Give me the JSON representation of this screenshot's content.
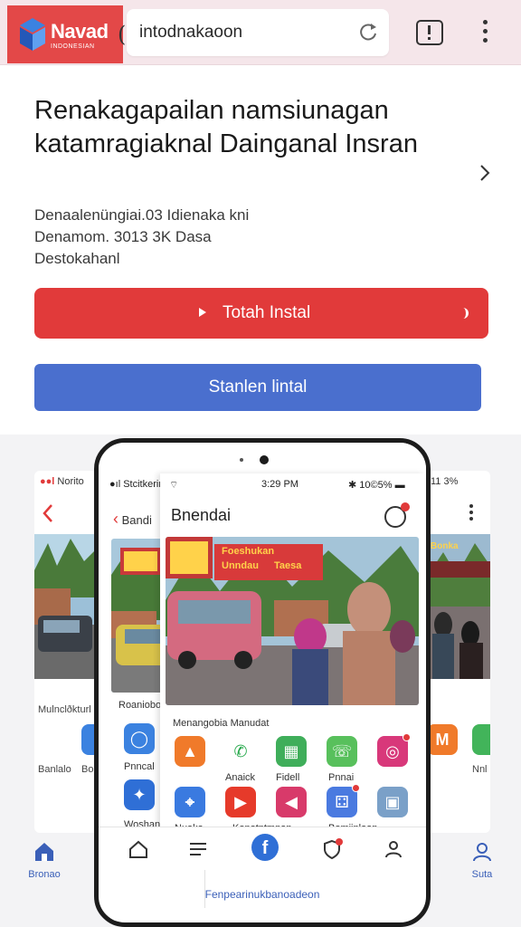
{
  "browser": {
    "logo_text": "Navad",
    "logo_sub": "INDONESIAN",
    "url": "intodnakaoon",
    "paren": "("
  },
  "main": {
    "title": "Renakagapailan namsiunagan katamragiaknal Dainganal Insran",
    "description_lines": [
      "Denaalenüngiai.03 Idienaka kni",
      "Denamom. 3013 3K Dasa",
      "Destokahanl"
    ],
    "primary_button": "Totah Instal",
    "secondary_button": "Stanlen lintal"
  },
  "preview": {
    "left_card": {
      "status": "Norito",
      "back_label": "",
      "caption": "Mulnclðkturl",
      "bottom_caption": "Banlalo",
      "bottom_caption_2": "Bo"
    },
    "back_screen": {
      "status": "Stcitkerind",
      "back_label": "Bandi",
      "caption": "Roaniobo",
      "icon_label_1": "Pnncal",
      "icon_label_2": "Woshan"
    },
    "fg_screen": {
      "time": "3:29 PM",
      "battery": "10©5%",
      "title": "Bnendai",
      "photo_banner_line1": "Foeshukan",
      "photo_banner_line2": "Unndau",
      "photo_banner_line3": "Taesa",
      "section_label": "Menangobia Manudat",
      "row1_labels": [
        "",
        "Anaick",
        "Fidell",
        "Pnnai",
        ""
      ],
      "row2_labels": [
        "Nuaka",
        "",
        "Konotntmnan",
        "",
        "Bomiinlaon"
      ]
    },
    "right_card": {
      "status": "11 3%",
      "caption": "Nnl",
      "banner": "Bonka"
    },
    "bottom_caption": "Fenpearinukbanoadeon",
    "page_tabs": [
      {
        "label": "Bronao"
      },
      {
        "label": "Suta"
      }
    ]
  }
}
